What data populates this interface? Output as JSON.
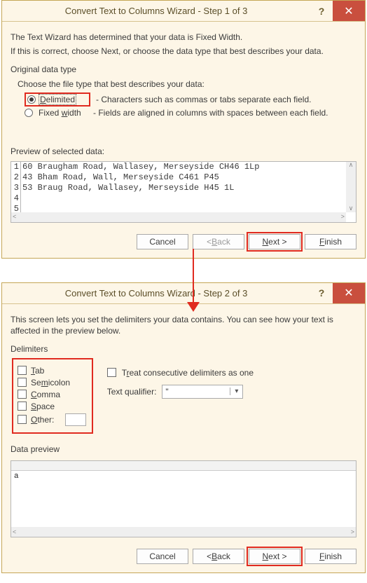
{
  "step1": {
    "title": "Convert Text to Columns Wizard - Step 1 of 3",
    "intro1": "The Text Wizard has determined that your data is Fixed Width.",
    "intro2": "If this is correct, choose Next, or choose the data type that best describes your data.",
    "group_label": "Original data type",
    "choose_label": "Choose the file type that best describes your data:",
    "delimited_label": "Delimited",
    "delimited_desc": "- Characters such as commas or tabs separate each field.",
    "fixed_label": "Fixed width",
    "fixed_desc": "- Fields are aligned in columns with spaces between each field.",
    "preview_label": "Preview of selected data:",
    "rows": [
      {
        "n": "1",
        "t": "60 Braugham Road, Wallasey, Merseyside CH46 1Lp"
      },
      {
        "n": "2",
        "t": "43 Bham Road, Wall, Merseyside C461 P45"
      },
      {
        "n": "3",
        "t": "53 Braug Road, Wallasey, Merseyside H45 1L"
      },
      {
        "n": "4",
        "t": ""
      },
      {
        "n": "5",
        "t": ""
      }
    ],
    "buttons": {
      "cancel": "Cancel",
      "back": "< Back",
      "next": "Next >",
      "finish": "Finish"
    }
  },
  "step2": {
    "title": "Convert Text to Columns Wizard - Step 2 of 3",
    "intro": "This screen lets you set the delimiters your data contains.  You can see how your text is affected in the preview below.",
    "delimiters_label": "Delimiters",
    "tab": "Tab",
    "semicolon": "Semicolon",
    "comma": "Comma",
    "space": "Space",
    "other": "Other:",
    "treat": "Treat consecutive delimiters as one",
    "qualifier_label": "Text qualifier:",
    "qualifier_value": "\"",
    "datapreview_label": "Data preview",
    "preview_cell": "a",
    "buttons": {
      "cancel": "Cancel",
      "back": "< Back",
      "next": "Next >",
      "finish": "Finish"
    }
  }
}
